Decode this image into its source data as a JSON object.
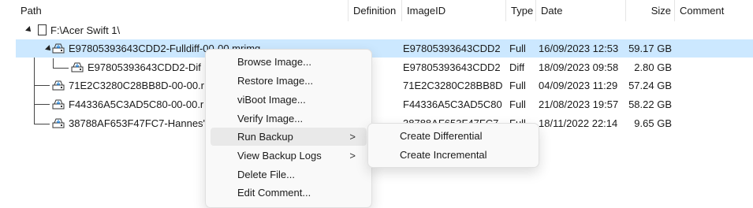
{
  "columns": {
    "path": "Path",
    "definition": "Definition",
    "image_id": "ImageID",
    "type": "Type",
    "date": "Date",
    "size": "Size",
    "comment": "Comment"
  },
  "root": {
    "label": "F:\\Acer Swift 1\\"
  },
  "rows": [
    {
      "name": "E97805393643CDD2-Fulldiff-00-00.mrimg",
      "image_id": "E97805393643CDD2",
      "type": "Full",
      "date": "16/09/2023 12:53",
      "size": "59.17 GB",
      "selected": true
    },
    {
      "name": "E97805393643CDD2-Dif",
      "image_id": "E97805393643CDD2",
      "type": "Diff",
      "date": "18/09/2023 09:58",
      "size": "2.80 GB"
    },
    {
      "name": "71E2C3280C28BB8D-00-00.r",
      "image_id": "71E2C3280C28BB8D",
      "type": "Full",
      "date": "04/09/2023 11:29",
      "size": "57.24 GB"
    },
    {
      "name": "F44336A5C3AD5C80-00-00.r",
      "image_id": "F44336A5C3AD5C80",
      "type": "Full",
      "date": "21/08/2023 19:57",
      "size": "58.22 GB"
    },
    {
      "name": "38788AF653F47FC7-Hannes'",
      "image_id": "38788AF653F47FC7",
      "type": "Full",
      "date": "18/11/2022 22:14",
      "size": "9.65 GB"
    }
  ],
  "context_menu": {
    "items": [
      {
        "label": "Browse Image..."
      },
      {
        "label": "Restore Image..."
      },
      {
        "label": "viBoot Image..."
      },
      {
        "label": "Verify Image..."
      },
      {
        "label": "Run Backup",
        "submenu": true,
        "hovered": true
      },
      {
        "label": "View Backup Logs",
        "submenu": true
      },
      {
        "label": "Delete File..."
      },
      {
        "label": "Edit Comment..."
      }
    ],
    "chevron": ">"
  },
  "submenu": {
    "items": [
      {
        "label": "Create Differential"
      },
      {
        "label": "Create Incremental"
      }
    ]
  },
  "colors": {
    "selection": "#cce8ff",
    "menu_bg": "#f9f9f9",
    "hover": "#e9e9e9"
  }
}
